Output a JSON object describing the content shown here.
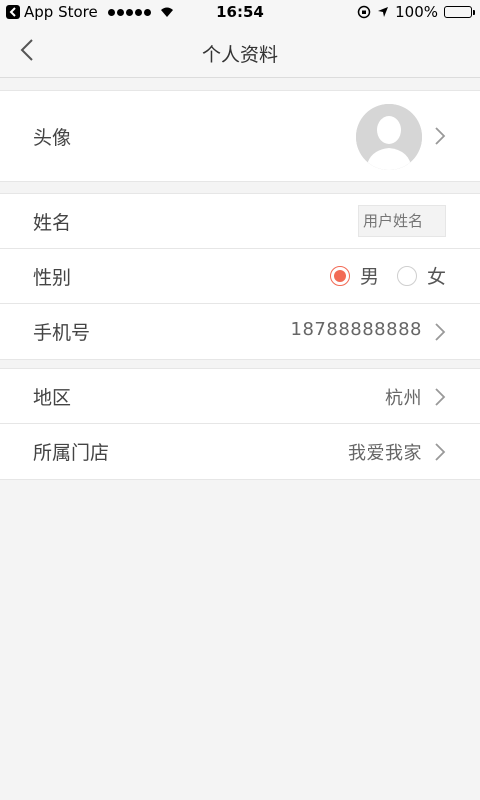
{
  "status_bar": {
    "carrier": "App Store",
    "time": "16:54",
    "battery": "100%"
  },
  "nav": {
    "title": "个人资料"
  },
  "profile": {
    "avatar_label": "头像",
    "name_label": "姓名",
    "name_placeholder": "用户姓名",
    "gender_label": "性别",
    "gender_options": [
      "男",
      "女"
    ],
    "gender_selected": "男",
    "phone_label": "手机号",
    "phone_value": "18788888888",
    "region_label": "地区",
    "region_value": "杭州",
    "store_label": "所属门店",
    "store_value": "我爱我家"
  },
  "colors": {
    "accent": "#f26a55",
    "background": "#f4f4f4"
  }
}
